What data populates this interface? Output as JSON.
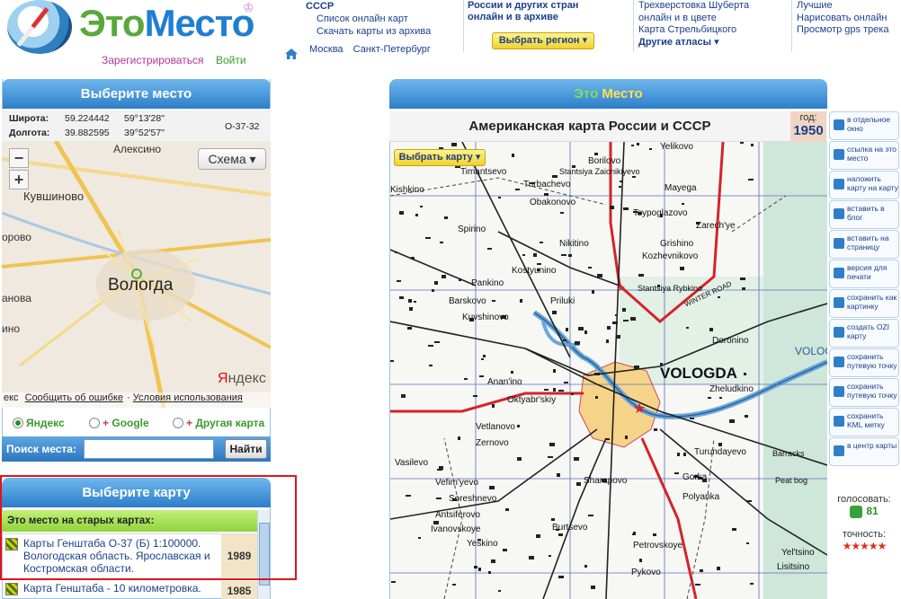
{
  "header": {
    "logo_part1": "Это",
    "logo_part2": "Место",
    "register": "Зарегистрироваться",
    "login": "Войти",
    "col1": {
      "title": "СССР",
      "items": [
        "Список онлайн карт",
        "Скачать карты из архива"
      ]
    },
    "cities": [
      "Москва",
      "Санкт-Петербург"
    ],
    "col2": {
      "line1": "России и других стран",
      "line2": "онлайн и в архиве"
    },
    "region_button": "Выбрать регион",
    "col3": [
      "Трехверстовка Шуберта",
      "онлайн и в цвете",
      "Карта Стрельбицкого"
    ],
    "col3_more": "Другие атласы",
    "col4": [
      "Лучшие",
      "Нарисовать онлайн",
      "Просмотр gps трека"
    ]
  },
  "left": {
    "choose_place_title": "Выберите место",
    "lat_label": "Широта:",
    "lat_decimal": "59.224442",
    "lat_dms": "59°13'28\"",
    "lon_label": "Долгота:",
    "lon_decimal": "39.882595",
    "lon_dms": "39°52'57\"",
    "sheet": "O-37-32",
    "minimap": {
      "scheme": "Схема",
      "labels": [
        "Алексино",
        "Кувшиново",
        "Вологда",
        "орово",
        "анова",
        "ино"
      ],
      "yandex": "Яндекс",
      "bottom": [
        "Сообщить об ошибке",
        "Условия использования"
      ],
      "bottom_prefix": "екс"
    },
    "providers": [
      "Яндекс",
      "Google",
      "Другая карта"
    ],
    "search_label": "Поиск места:",
    "search_placeholder": "",
    "search_button": "Найти",
    "choose_map_title": "Выберите карту",
    "old_maps_title": "Это место на старых картах:",
    "map_items": [
      {
        "text": "Карты Генштаба О-37 (Б) 1:100000. Вологодская область. Ярославская и Костромская области.",
        "year": "1989"
      },
      {
        "text": "Карта Генштаба - 10 километровка.",
        "year": "1985"
      }
    ]
  },
  "main": {
    "title": "Это Место",
    "map_title": "Американская карта России и СССР",
    "year_label": "год:",
    "year": "1950",
    "select_map": "Выбрать карту",
    "place_labels": [
      "Yelikovo",
      "Timantsevo",
      "Borilovo",
      "Stantsiya Zaionikiyevo",
      "Mayega",
      "Kishkino",
      "Turbachevo",
      "Obakonovo",
      "Tsypoglazovo",
      "Zarech'ye",
      "Spirino",
      "Nikitino",
      "Grishino",
      "Kozhevnikovo",
      "Kostyunino",
      "Pankino",
      "Stantsiya Rybkino",
      "Barskovo",
      "Kuvshinovo",
      "Priluki",
      "Doronino",
      "VOLOGDA",
      "Anan'ino",
      "Zheludkino",
      "Oktyabr'skiy",
      "Vetlanovo",
      "Zernovo",
      "Turundayevo",
      "Barracks",
      "Vasilevo",
      "Gorka",
      "Vefim'yevo",
      "Sharapovo",
      "Polyanka",
      "Soreshnevo",
      "Antsiferovo",
      "Ivanovskoye",
      "Burtsevo",
      "Petrovskoye",
      "Yeskino",
      "Pykovo",
      "Yel'tsino",
      "Lisitsino",
      "WINTER ROAD",
      "VOLOG",
      "Peat bog"
    ]
  },
  "tools": [
    "в отдельное окно",
    "ссылка на это место",
    "наложить карту на карту",
    "вставить в блог",
    "вставить на страницу",
    "версия для печати",
    "сохранить как картинку",
    "создать OZI карту",
    "сохранить путевую точку",
    "сохранить путевую точку",
    "сохранить KML метку",
    "в центр карты"
  ],
  "vote": {
    "label": "голосовать:",
    "count": "81"
  },
  "accuracy": {
    "label": "точность:",
    "stars": "★★★★★"
  }
}
